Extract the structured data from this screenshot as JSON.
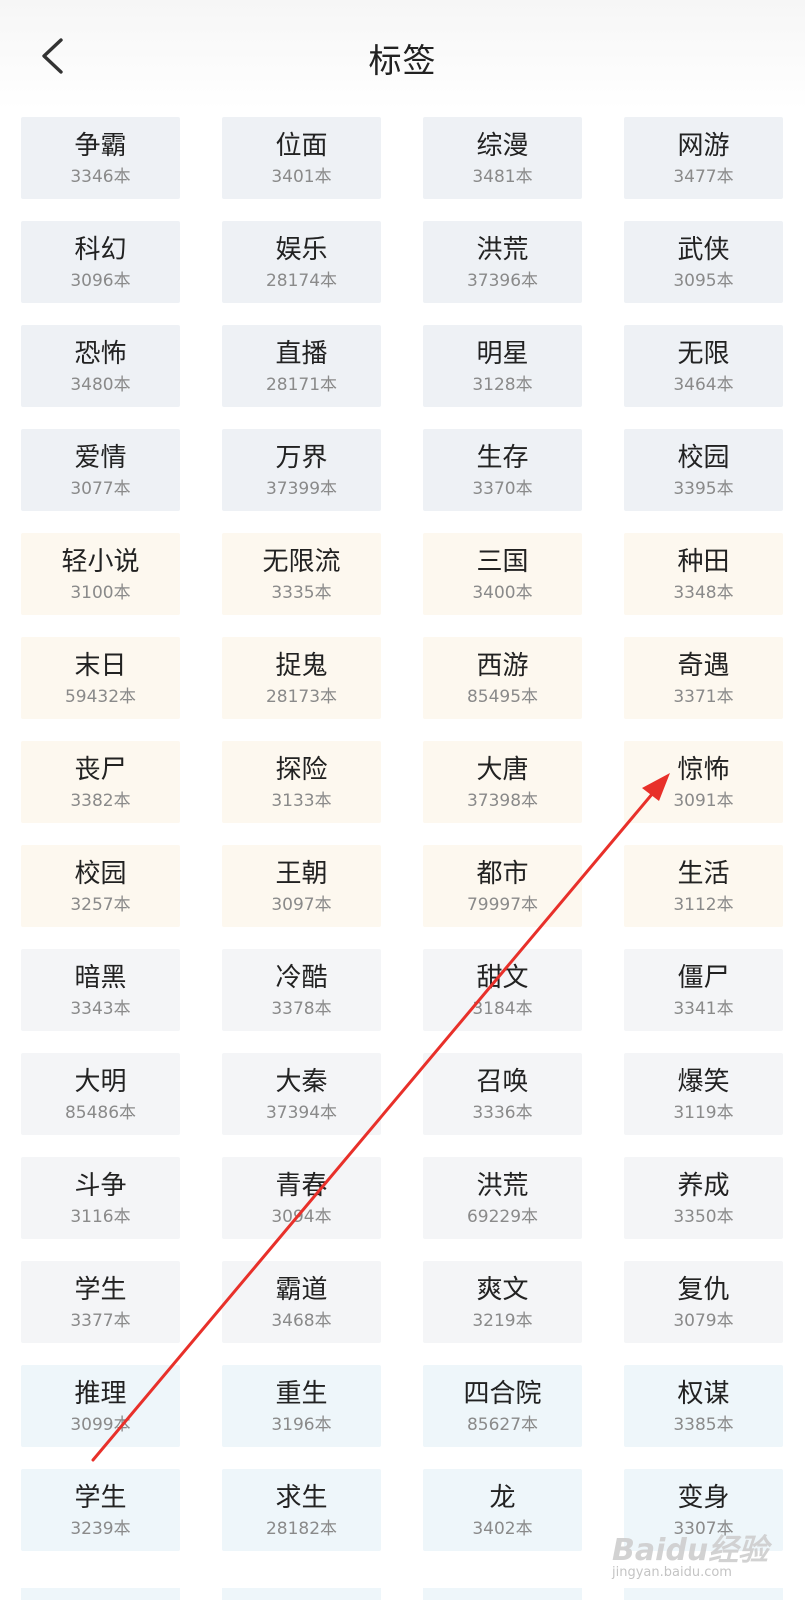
{
  "header": {
    "title": "标签",
    "back_icon": "chevron-left-icon"
  },
  "tags": [
    {
      "name": "争霸",
      "count": "3346本",
      "style": "gray"
    },
    {
      "name": "位面",
      "count": "3401本",
      "style": "gray"
    },
    {
      "name": "综漫",
      "count": "3481本",
      "style": "gray"
    },
    {
      "name": "网游",
      "count": "3477本",
      "style": "gray"
    },
    {
      "name": "科幻",
      "count": "3096本",
      "style": "gray"
    },
    {
      "name": "娱乐",
      "count": "28174本",
      "style": "gray"
    },
    {
      "name": "洪荒",
      "count": "37396本",
      "style": "gray"
    },
    {
      "name": "武侠",
      "count": "3095本",
      "style": "gray"
    },
    {
      "name": "恐怖",
      "count": "3480本",
      "style": "gray"
    },
    {
      "name": "直播",
      "count": "28171本",
      "style": "gray"
    },
    {
      "name": "明星",
      "count": "3128本",
      "style": "gray"
    },
    {
      "name": "无限",
      "count": "3464本",
      "style": "gray"
    },
    {
      "name": "爱情",
      "count": "3077本",
      "style": "gray"
    },
    {
      "name": "万界",
      "count": "37399本",
      "style": "gray"
    },
    {
      "name": "生存",
      "count": "3370本",
      "style": "gray"
    },
    {
      "name": "校园",
      "count": "3395本",
      "style": "gray"
    },
    {
      "name": "轻小说",
      "count": "3100本",
      "style": "cream"
    },
    {
      "name": "无限流",
      "count": "3335本",
      "style": "cream"
    },
    {
      "name": "三国",
      "count": "3400本",
      "style": "cream"
    },
    {
      "name": "种田",
      "count": "3348本",
      "style": "cream"
    },
    {
      "name": "末日",
      "count": "59432本",
      "style": "cream"
    },
    {
      "name": "捉鬼",
      "count": "28173本",
      "style": "cream"
    },
    {
      "name": "西游",
      "count": "85495本",
      "style": "cream"
    },
    {
      "name": "奇遇",
      "count": "3371本",
      "style": "cream"
    },
    {
      "name": "丧尸",
      "count": "3382本",
      "style": "cream"
    },
    {
      "name": "探险",
      "count": "3133本",
      "style": "cream"
    },
    {
      "name": "大唐",
      "count": "37398本",
      "style": "cream"
    },
    {
      "name": "惊怖",
      "count": "3091本",
      "style": "cream"
    },
    {
      "name": "校园",
      "count": "3257本",
      "style": "cream"
    },
    {
      "name": "王朝",
      "count": "3097本",
      "style": "cream"
    },
    {
      "name": "都市",
      "count": "79997本",
      "style": "cream"
    },
    {
      "name": "生活",
      "count": "3112本",
      "style": "cream"
    },
    {
      "name": "暗黑",
      "count": "3343本",
      "style": "light"
    },
    {
      "name": "冷酷",
      "count": "3378本",
      "style": "light"
    },
    {
      "name": "甜文",
      "count": "3184本",
      "style": "light"
    },
    {
      "name": "僵尸",
      "count": "3341本",
      "style": "light"
    },
    {
      "name": "大明",
      "count": "85486本",
      "style": "light"
    },
    {
      "name": "大秦",
      "count": "37394本",
      "style": "light"
    },
    {
      "name": "召唤",
      "count": "3336本",
      "style": "light"
    },
    {
      "name": "爆笑",
      "count": "3119本",
      "style": "light"
    },
    {
      "name": "斗争",
      "count": "3116本",
      "style": "light"
    },
    {
      "name": "青春",
      "count": "3094本",
      "style": "light"
    },
    {
      "name": "洪荒",
      "count": "69229本",
      "style": "light"
    },
    {
      "name": "养成",
      "count": "3350本",
      "style": "light"
    },
    {
      "name": "学生",
      "count": "3377本",
      "style": "light"
    },
    {
      "name": "霸道",
      "count": "3468本",
      "style": "light"
    },
    {
      "name": "爽文",
      "count": "3219本",
      "style": "light"
    },
    {
      "name": "复仇",
      "count": "3079本",
      "style": "light"
    },
    {
      "name": "推理",
      "count": "3099本",
      "style": "blue"
    },
    {
      "name": "重生",
      "count": "3196本",
      "style": "blue"
    },
    {
      "name": "四合院",
      "count": "85627本",
      "style": "blue"
    },
    {
      "name": "权谋",
      "count": "3385本",
      "style": "blue"
    },
    {
      "name": "学生",
      "count": "3239本",
      "style": "blue"
    },
    {
      "name": "求生",
      "count": "28182本",
      "style": "blue"
    },
    {
      "name": "龙",
      "count": "3402本",
      "style": "blue"
    },
    {
      "name": "变身",
      "count": "3307本",
      "style": "blue"
    }
  ],
  "annotation": {
    "color": "#e8302a"
  },
  "watermark": {
    "main": "Baidu经验",
    "sub": "jingyan.baidu.com"
  }
}
